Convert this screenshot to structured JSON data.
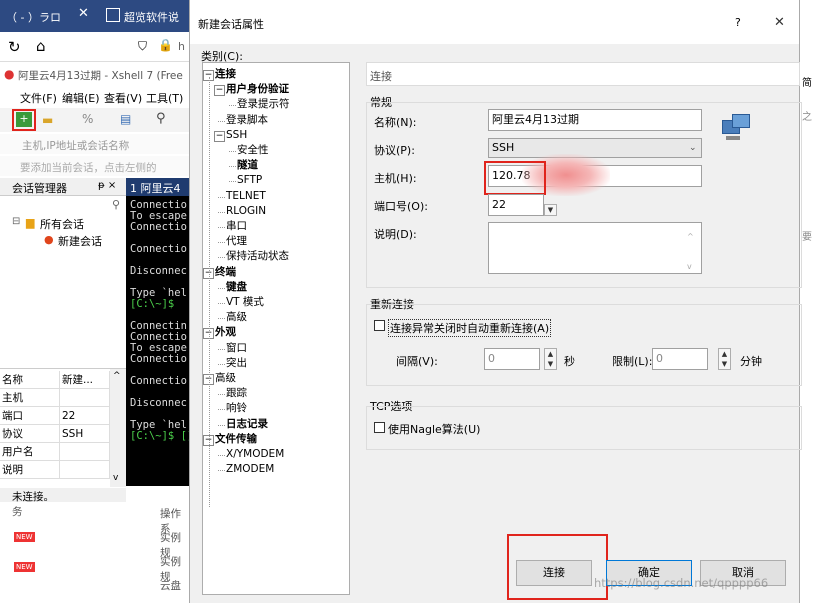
{
  "background": {
    "tab_partial_left": "（ - ）ラロ",
    "tab_partial_right": "超览软件说",
    "address_letter": "h",
    "window_title": "阿里云4月13过期 - Xshell 7 (Free",
    "menu": [
      "文件(F)",
      "编辑(E)",
      "查看(V)",
      "工具(T)"
    ],
    "host_hint": "主机,IP地址或会话名称",
    "add_hint": "要添加当前会话，点击左侧的",
    "session_manager_title": "会话管理器",
    "pin": "ᵽ ×",
    "tree_root": "所有会话",
    "tree_child": "新建会话",
    "props": {
      "headers": [
        "名称",
        "新建..."
      ],
      "rows": [
        [
          "主机",
          ""
        ],
        [
          "端口",
          "22"
        ],
        [
          "协议",
          "SSH"
        ],
        [
          "用户名",
          ""
        ],
        [
          "说明",
          ""
        ]
      ]
    },
    "status": "未连接。",
    "terminal_tab": "1 阿里云4",
    "terminal_lines": [
      "Connectio",
      "To escape",
      "Connectio",
      "",
      "Connectio",
      "",
      "Disconnec",
      "",
      "Type `hel",
      "[C:\\~]$",
      "",
      "Connectin",
      "Connectio",
      "To escape",
      "Connectio",
      "",
      "Connectio",
      "",
      "Disconnec",
      "",
      "Type `hel",
      "[C:\\~]$ []"
    ],
    "bottom_items": [
      "操作系",
      "实例规",
      "实例规",
      "云盘"
    ],
    "bottom_left": "务",
    "new_badge": "NEW",
    "right_edge_1": "简",
    "right_edge_2": "之",
    "right_edge_3": "要"
  },
  "dialog": {
    "title": "新建会话属性",
    "help_btn": "?",
    "close_btn": "✕",
    "category_label": "类别(C):",
    "tree": [
      {
        "label": "连接",
        "bold": true
      },
      {
        "label": "用户身份验证",
        "bold": true
      },
      {
        "label": "登录提示符",
        "bold": false
      },
      {
        "label": "登录脚本",
        "bold": false
      },
      {
        "label": "SSH",
        "bold": false
      },
      {
        "label": "安全性",
        "bold": false
      },
      {
        "label": "隧道",
        "bold": true
      },
      {
        "label": "SFTP",
        "bold": false
      },
      {
        "label": "TELNET",
        "bold": false
      },
      {
        "label": "RLOGIN",
        "bold": false
      },
      {
        "label": "串口",
        "bold": false
      },
      {
        "label": "代理",
        "bold": false
      },
      {
        "label": "保持活动状态",
        "bold": false
      },
      {
        "label": "终端",
        "bold": true
      },
      {
        "label": "键盘",
        "bold": true
      },
      {
        "label": "VT 模式",
        "bold": false
      },
      {
        "label": "高级",
        "bold": false
      },
      {
        "label": "外观",
        "bold": true
      },
      {
        "label": "窗口",
        "bold": false
      },
      {
        "label": "突出",
        "bold": false
      },
      {
        "label": "高级",
        "bold": false
      },
      {
        "label": "跟踪",
        "bold": false
      },
      {
        "label": "响铃",
        "bold": false
      },
      {
        "label": "日志记录",
        "bold": true
      },
      {
        "label": "文件传输",
        "bold": true
      },
      {
        "label": "X/YMODEM",
        "bold": false
      },
      {
        "label": "ZMODEM",
        "bold": false
      }
    ],
    "section_title": "连接",
    "general_label": "常规",
    "name_label": "名称(N):",
    "name_value": "阿里云4月13过期",
    "protocol_label": "协议(P):",
    "protocol_value": "SSH",
    "host_label": "主机(H):",
    "host_value": "120.78",
    "port_label": "端口号(O):",
    "port_value": "22",
    "desc_label": "说明(D):",
    "reconnect_title": "重新连接",
    "reconnect_check": "连接异常关闭时自动重新连接(A)",
    "interval_label": "间隔(V):",
    "interval_value": "0",
    "interval_unit": "秒",
    "limit_label": "限制(L):",
    "limit_value": "0",
    "limit_unit": "分钟",
    "tcp_title": "TCP选项",
    "nagle_check": "使用Nagle算法(U)",
    "btn_connect": "连接",
    "btn_ok": "确定",
    "btn_cancel": "取消",
    "watermark": "https://blog.csdn.net/qpppp66"
  }
}
